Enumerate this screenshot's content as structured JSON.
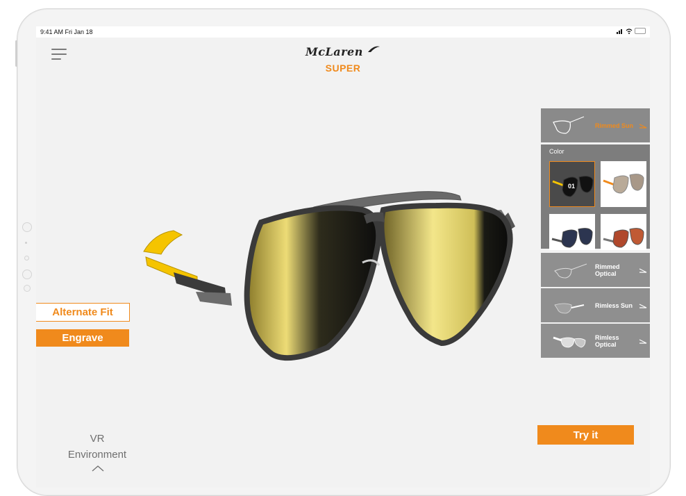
{
  "status_bar": {
    "time": "9:41 AM Fri Jan 18"
  },
  "header": {
    "brand": "McLaren",
    "model": "SUPER"
  },
  "left_actions": {
    "alternate_fit": "Alternate Fit",
    "engrave": "Engrave"
  },
  "vr": {
    "line1": "VR",
    "line2": "Environment"
  },
  "try_it": "Try it",
  "style_panel": {
    "selected_style": "Rimmed Sun",
    "color_title": "Color",
    "swatches": [
      {
        "number": "01",
        "selected": true
      },
      {
        "number": "",
        "selected": false
      },
      {
        "number": "",
        "selected": false
      },
      {
        "number": "",
        "selected": false
      }
    ],
    "styles": [
      "Rimmed Optical",
      "Rimless Sun",
      "Rimless Optical"
    ]
  },
  "colors": {
    "accent": "#f08a1c",
    "panel": "#8f8f8f",
    "lens": "#e8d36a",
    "temple": "#f5c400"
  }
}
